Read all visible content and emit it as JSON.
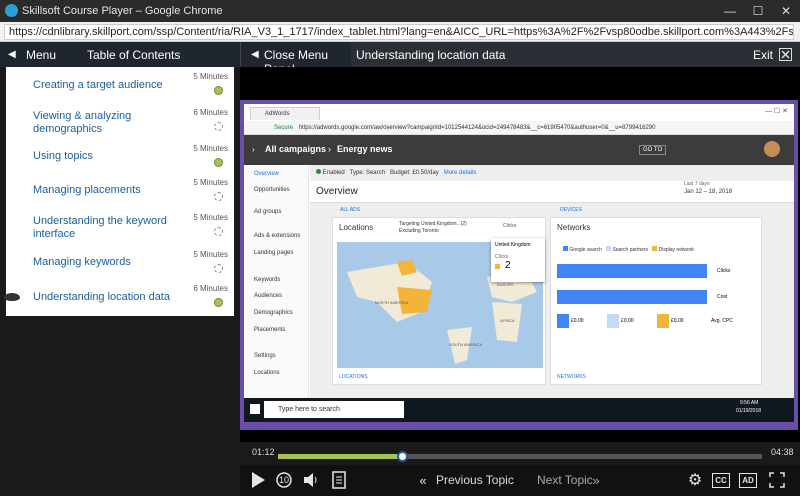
{
  "window": {
    "title": "Skillsoft Course Player – Google Chrome",
    "url": "https://cdnlibrary.skillport.com/ssp/Content/ria/RIA_V3_1_1717/index_tablet.html?lang=en&AICC_URL=https%3A%2F%2Fvsp80odbe.skillport.com%3A443%2Fskillportbe%2Fs…",
    "controls": {
      "minimize": "—",
      "maximize": "☐",
      "close": "✕"
    }
  },
  "topnav": {
    "menu_label": "Menu",
    "menu_arrow": "◀",
    "toc_label": "Table of Contents",
    "close_panel_label": "Close Menu Panel",
    "close_panel_arrow": "◀",
    "current_topic": "Understanding location data",
    "exit_label": "Exit",
    "exit_icon": "close-box-icon"
  },
  "toc": {
    "items": [
      {
        "title": "Creating a target audience",
        "duration": "5 Minutes",
        "status": "done"
      },
      {
        "title": "Viewing & analyzing demographics",
        "duration": "6 Minutes",
        "status": "todo"
      },
      {
        "title": "Using topics",
        "duration": "5 Minutes",
        "status": "done"
      },
      {
        "title": "Managing placements",
        "duration": "5 Minutes",
        "status": "todo"
      },
      {
        "title": "Understanding the keyword interface",
        "duration": "5 Minutes",
        "status": "todo"
      },
      {
        "title": "Managing keywords",
        "duration": "5 Minutes",
        "status": "todo"
      },
      {
        "title": "Understanding location data",
        "duration": "6 Minutes",
        "status": "done",
        "current": true
      }
    ]
  },
  "video": {
    "tab_title": "AdWords",
    "secure_label": "Secure",
    "url": "https://adwords.google.com/aw/overview?campaignId=1012544124&ocid=249478483&__c=61905470&authuser=0&__u=8799416290",
    "breadcrumb_all": "All campaigns",
    "breadcrumb_campaign": "Energy news",
    "goto_label": "GO TO",
    "status_enabled": "Enabled",
    "type_label": "Type: Search",
    "budget_label": "Budget: £0.50/day",
    "more_details": "More details",
    "date_range_label": "Last 7 days",
    "date_range": "Jan 12 – 18, 2018",
    "overview_title": "Overview",
    "all_ads": "ALL ADS",
    "devices": "DEVICES",
    "locations_title": "Locations",
    "locations_targeting": "Targeting United Kingdom...(2)",
    "locations_excluding": "Excluding Toronto",
    "clicks_dropdown": "Clicks",
    "tooltip_country": "United Kingdom",
    "tooltip_metric": "Clicks",
    "tooltip_value": "2",
    "map_labels": [
      "NORTH AMERICA",
      "EUROPE",
      "AFRICA",
      "SOUTH AMERICA"
    ],
    "locations_link": "LOCATIONS",
    "networks_title": "Networks",
    "networks_legend": [
      "Google search",
      "Search partners",
      "Display network"
    ],
    "networks_selects": [
      "Clicks",
      "Cost",
      "Avg. CPC"
    ],
    "networks_values": [
      "£0.00",
      "£0.00",
      "£0.00"
    ],
    "networks_link": "NETWORKS",
    "sidebar": [
      "Overview",
      "Opportunities",
      "Ad groups",
      "Ads & extensions",
      "Landing pages",
      "Keywords",
      "Audiences",
      "Demographics",
      "Placements",
      "Settings",
      "Locations"
    ],
    "taskbar_search": "Type here to search",
    "taskbar_time": "9:56 AM",
    "taskbar_date": "01/19/2018"
  },
  "player": {
    "time_current": "01:12",
    "time_total": "04:38",
    "progress_fraction": 0.259,
    "prev_topic": "Previous Topic",
    "next_topic": "Next Topic",
    "cc_label": "CC",
    "ad_label": "AD",
    "replay_label": "10"
  },
  "colors": {
    "accent": "#a8c25a",
    "link": "#1b5e9e",
    "frame": "#6a4fa8",
    "progress_fill": "#a8c25a"
  }
}
